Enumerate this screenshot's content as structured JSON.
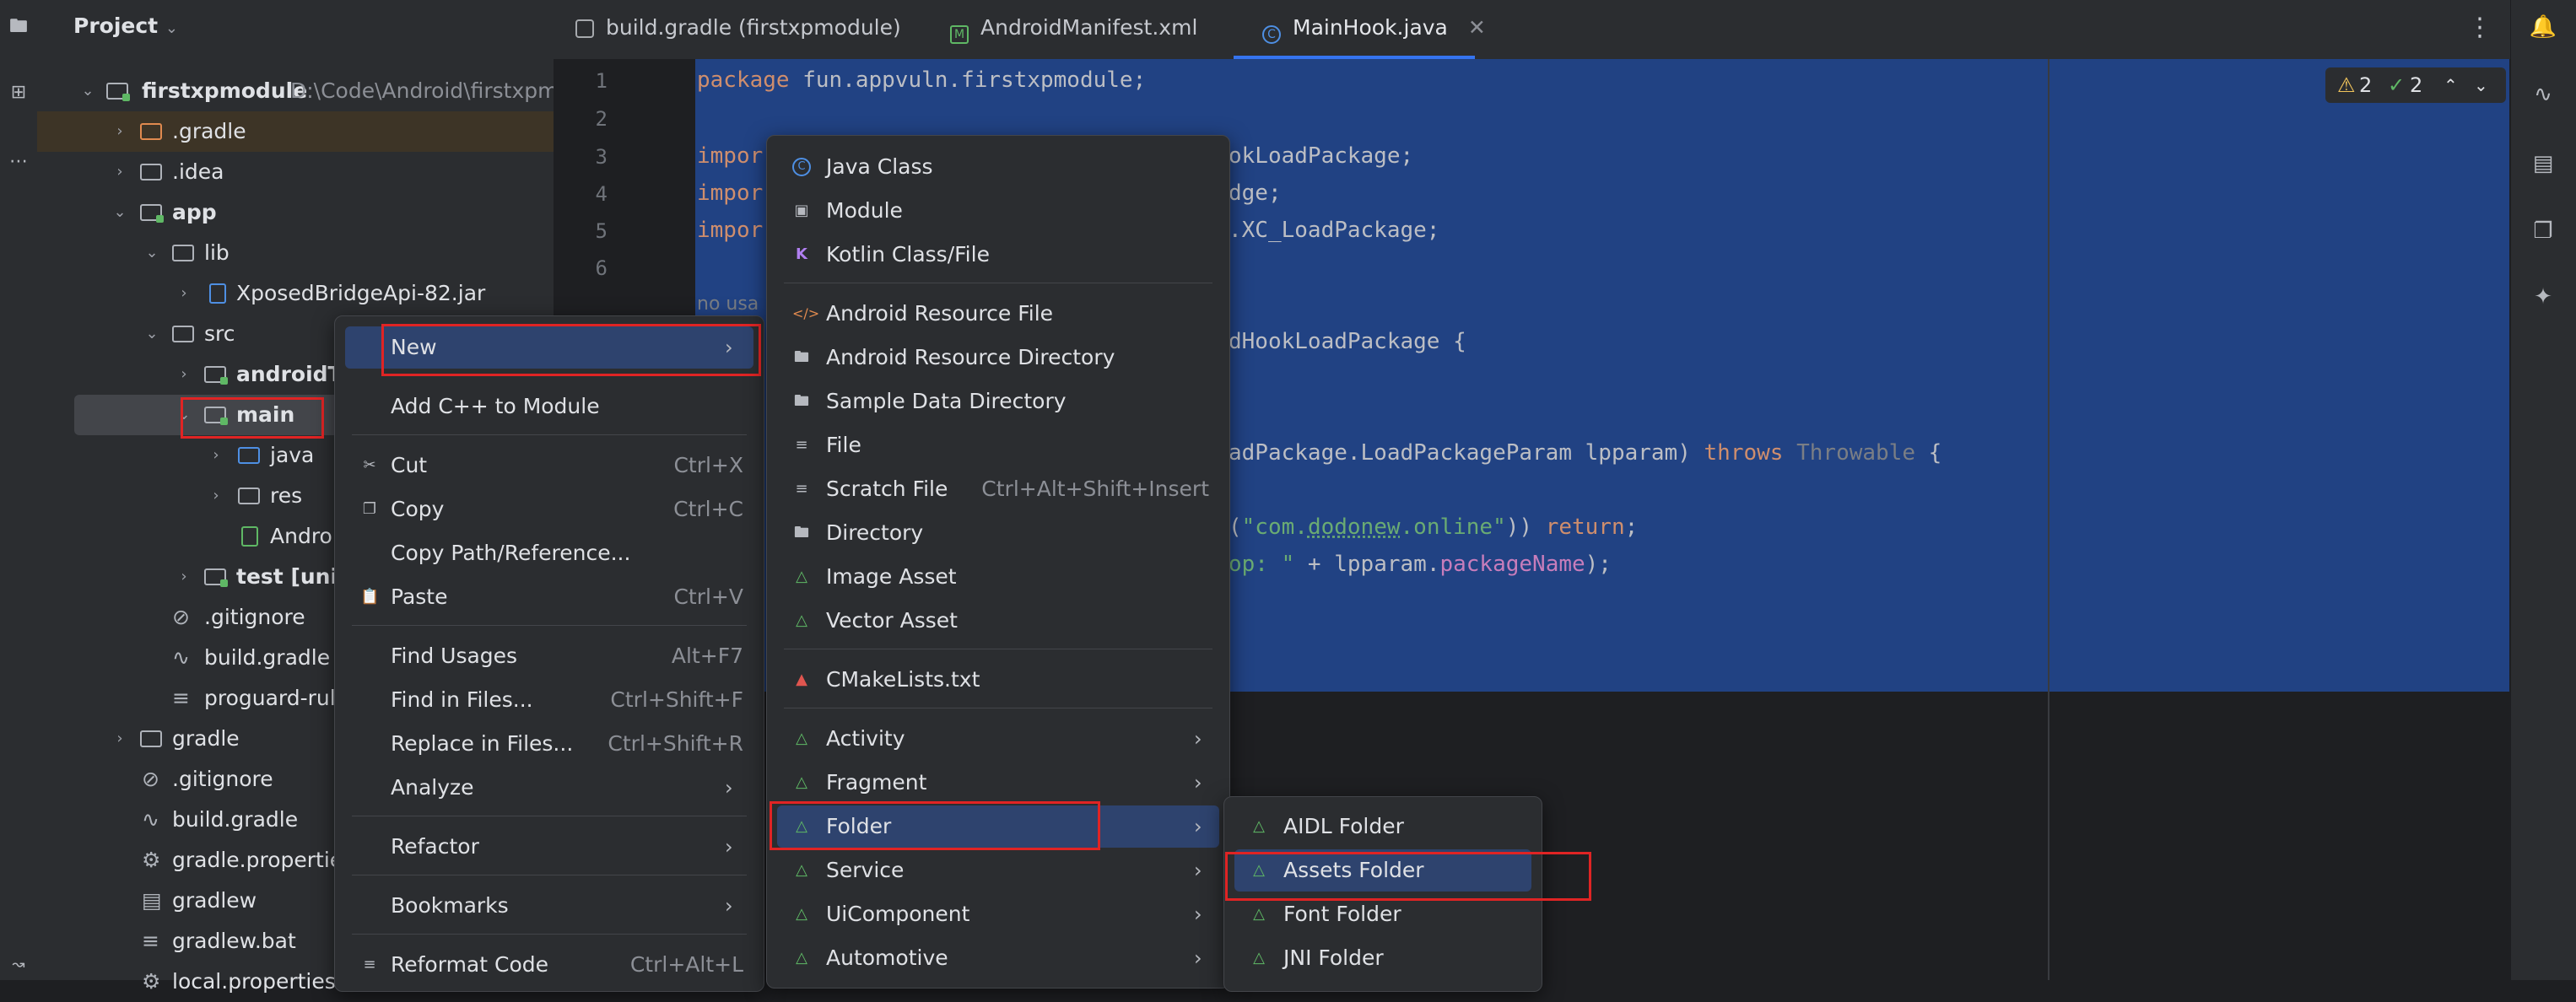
{
  "project_panel": {
    "title": "Project",
    "rows": [
      {
        "label": "firstxpmodule",
        "extra": "D:\\Code\\Android\\firstxpmo"
      },
      {
        "label": ".gradle"
      },
      {
        "label": ".idea"
      },
      {
        "label": "app"
      },
      {
        "label": "lib"
      },
      {
        "label": "XposedBridgeApi-82.jar"
      },
      {
        "label": "src"
      },
      {
        "label": "androidTe"
      },
      {
        "label": "main"
      },
      {
        "label": "java"
      },
      {
        "label": "res"
      },
      {
        "label": "Androi"
      },
      {
        "label": "test [unit"
      },
      {
        "label": ".gitignore"
      },
      {
        "label": "build.gradle"
      },
      {
        "label": "proguard-rule"
      },
      {
        "label": "gradle"
      },
      {
        "label": ".gitignore"
      },
      {
        "label": "build.gradle"
      },
      {
        "label": "gradle.properties"
      },
      {
        "label": "gradlew"
      },
      {
        "label": "gradlew.bat"
      },
      {
        "label": "local.properties"
      }
    ]
  },
  "tabs": [
    {
      "label": "build.gradle (firstxpmodule)"
    },
    {
      "label": "AndroidManifest.xml"
    },
    {
      "label": "MainHook.java"
    }
  ],
  "editor": {
    "line_numbers": [
      "1",
      "2",
      "3",
      "4",
      "5",
      "6"
    ],
    "code": {
      "l1_kw": "package",
      "l1_rest": " fun.appvuln.firstxpmodule;",
      "l3_kw": "impor",
      "l3_rest": "okLoadPackage;",
      "l4_kw": "impor",
      "l4_rest": "dge;",
      "l5_kw": "impor",
      "l5_rest": ".XC_LoadPackage;",
      "usages": "no usa",
      "l8_rest": "dHookLoadPackage {",
      "l11_rest": "adPackage.LoadPackageParam lpparam) ",
      "l11_throws": "throws",
      "l11_throwable": " Throwable",
      "l11_brace": " {",
      "l13_pre": "(",
      "l13_str1": "\"com.",
      "l13_str2": "dodonew",
      "l13_str3": ".online\"",
      "l13_post": ")) ",
      "l13_ret": "return",
      "l13_end": ";",
      "l14_str": "op: \"",
      "l14_mid": " + lpparam.",
      "l14_fld": "packageName",
      "l14_end": ");"
    },
    "inspections": {
      "warnings": "2",
      "checks": "2"
    }
  },
  "context_menu": [
    {
      "label": "New",
      "mnemonic": "N",
      "submenu": true
    },
    {
      "label": "Add C++ to Module"
    },
    {
      "label": "Cut",
      "shortcut": "Ctrl+X"
    },
    {
      "label": "Copy",
      "shortcut": "Ctrl+C"
    },
    {
      "label": "Copy Path/Reference..."
    },
    {
      "label": "Paste",
      "shortcut": "Ctrl+V"
    },
    {
      "label": "Find Usages",
      "shortcut": "Alt+F7"
    },
    {
      "label": "Find in Files...",
      "shortcut": "Ctrl+Shift+F"
    },
    {
      "label": "Replace in Files...",
      "shortcut": "Ctrl+Shift+R"
    },
    {
      "label": "Analyze",
      "submenu": true
    },
    {
      "label": "Refactor",
      "submenu": true
    },
    {
      "label": "Bookmarks",
      "submenu": true
    },
    {
      "label": "Reformat Code",
      "shortcut": "Ctrl+Alt+L"
    }
  ],
  "new_submenu": [
    {
      "label": "Java Class"
    },
    {
      "label": "Module"
    },
    {
      "label": "Kotlin Class/File"
    },
    {
      "label": "Android Resource File"
    },
    {
      "label": "Android Resource Directory"
    },
    {
      "label": "Sample Data Directory"
    },
    {
      "label": "File"
    },
    {
      "label": "Scratch File",
      "shortcut": "Ctrl+Alt+Shift+Insert"
    },
    {
      "label": "Directory"
    },
    {
      "label": "Image Asset"
    },
    {
      "label": "Vector Asset"
    },
    {
      "label": "CMakeLists.txt"
    },
    {
      "label": "Activity",
      "submenu": true
    },
    {
      "label": "Fragment",
      "submenu": true
    },
    {
      "label": "Folder",
      "submenu": true
    },
    {
      "label": "Service",
      "submenu": true
    },
    {
      "label": "UiComponent",
      "submenu": true
    },
    {
      "label": "Automotive",
      "submenu": true
    }
  ],
  "folder_submenu": [
    {
      "label": "AIDL Folder"
    },
    {
      "label": "Assets Folder"
    },
    {
      "label": "Font Folder"
    },
    {
      "label": "JNI Folder"
    }
  ],
  "colors": {
    "selection": "#214283",
    "highlight_box": "#e02424",
    "accent": "#3574f0"
  }
}
